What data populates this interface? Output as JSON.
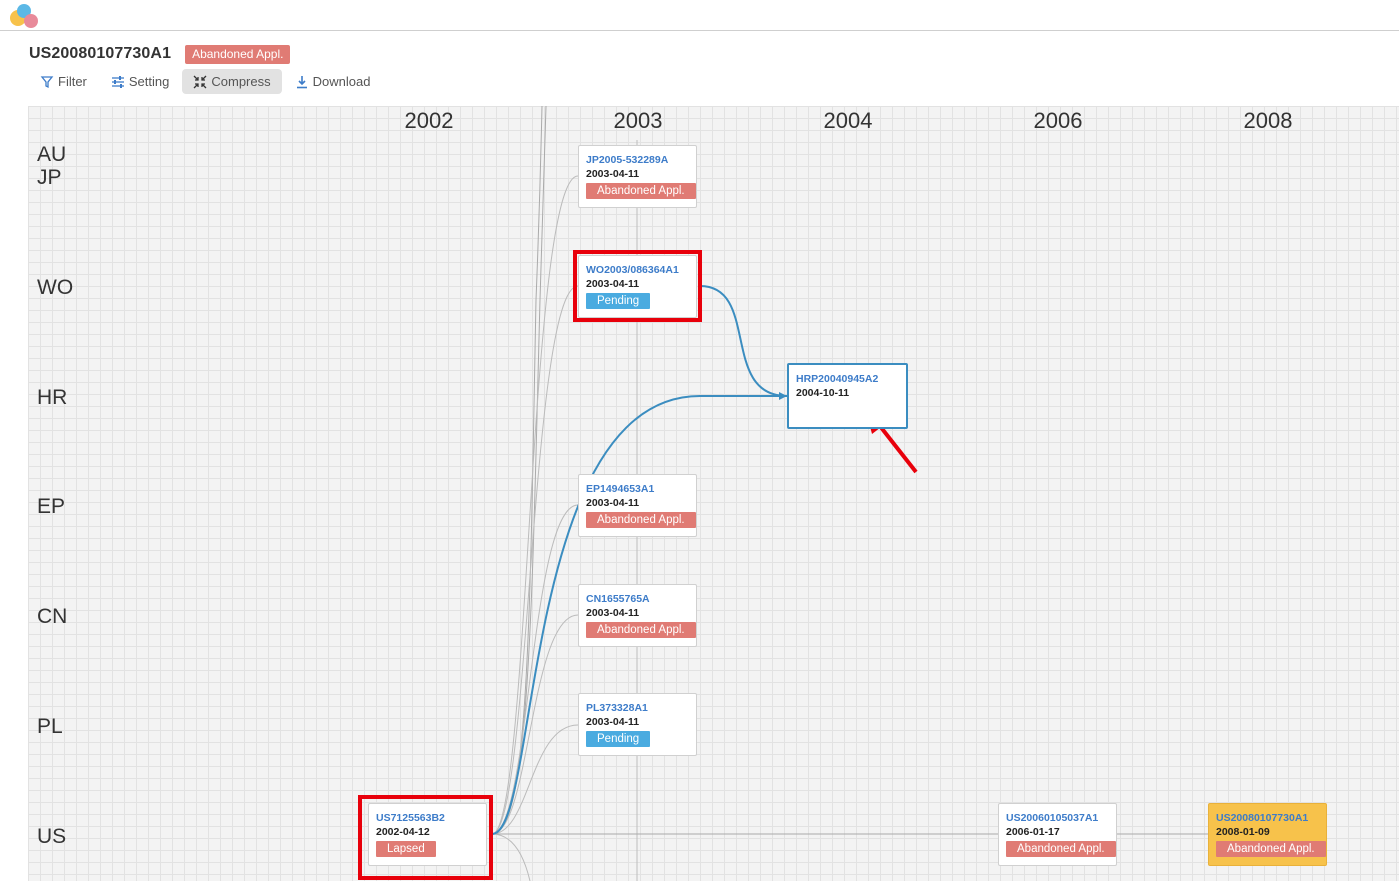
{
  "header": {
    "title": "US20080107730A1",
    "status": "Abandoned Appl."
  },
  "toolbar": {
    "filter": "Filter",
    "setting": "Setting",
    "compress": "Compress",
    "download": "Download"
  },
  "timeline": {
    "years": [
      "2002",
      "2003",
      "2004",
      "2006",
      "2008"
    ],
    "countries": [
      "AU",
      "JP",
      "WO",
      "HR",
      "EP",
      "CN",
      "PL",
      "US"
    ]
  },
  "nodes": [
    {
      "number": "JP2005-532289A",
      "date": "2003-04-11",
      "status": "Abandoned Appl."
    },
    {
      "number": "WO2003/086364A1",
      "date": "2003-04-11",
      "status": "Pending"
    },
    {
      "number": "HRP20040945A2",
      "date": "2004-10-11",
      "status": ""
    },
    {
      "number": "EP1494653A1",
      "date": "2003-04-11",
      "status": "Abandoned Appl."
    },
    {
      "number": "CN1655765A",
      "date": "2003-04-11",
      "status": "Abandoned Appl."
    },
    {
      "number": "PL373328A1",
      "date": "2003-04-11",
      "status": "Pending"
    },
    {
      "number": "US7125563B2",
      "date": "2002-04-12",
      "status": "Lapsed"
    },
    {
      "number": "US20060105037A1",
      "date": "2006-01-17",
      "status": "Abandoned Appl."
    },
    {
      "number": "US20080107730A1",
      "date": "2008-01-09",
      "status": "Abandoned Appl."
    }
  ],
  "colors": {
    "abandoned": "#e07b74",
    "pending": "#4aabe0",
    "link_highlight": "#3b8dc0",
    "selected_node": "#f7c24b",
    "annotation_red": "#e8000b"
  }
}
